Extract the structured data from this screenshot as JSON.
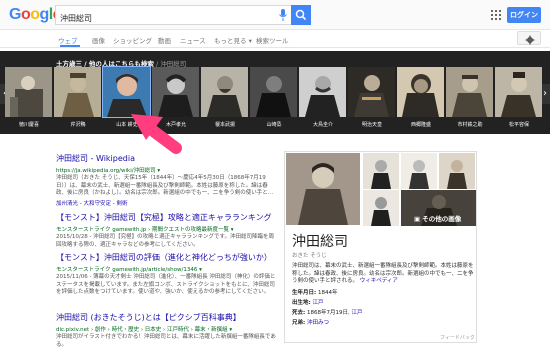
{
  "header": {
    "logo": [
      "G",
      "o",
      "o",
      "g",
      "l",
      "e"
    ],
    "search_value": "沖田総司",
    "login_label": "ログイン"
  },
  "tabs": [
    {
      "label": "ウェブ",
      "active": true
    },
    {
      "label": "画像"
    },
    {
      "label": "ショッピング"
    },
    {
      "label": "動画"
    },
    {
      "label": "ニュース"
    },
    {
      "label": "もっと見る ▾"
    },
    {
      "label": "検索ツール"
    }
  ],
  "carousel": {
    "title": "土方歳三 / 他の人はこちらも検索",
    "crumb": " / 沖田総司",
    "people": [
      {
        "name": "徳川慶喜"
      },
      {
        "name": "芹沢鴨"
      },
      {
        "name": "山本 耕史"
      },
      {
        "name": "木戸孝允"
      },
      {
        "name": "榎本武揚"
      },
      {
        "name": "山崎烝"
      },
      {
        "name": "大鳥圭介"
      },
      {
        "name": "明治天皇"
      },
      {
        "name": "西郷隆盛"
      },
      {
        "name": "市村鉄之助"
      },
      {
        "name": "松平容保"
      }
    ]
  },
  "results": [
    {
      "title": "沖田総司 - Wikipedia",
      "url": "https://ja.wikipedia.org/wiki/沖田総司 ▾",
      "snippet": "沖田総司（おきた そうじ、天保15年（1844年）〜慶応4年5月30日（1868年7月19日））は、幕末の武士、新選組一番隊組長及び撃剣師範。本姓は藤原を称した。諱は春政、後に房良（かねよし）。幼名は宗次郎。新選組の中でも一、二を争う剣の使い手と…",
      "link": "加州清光 - 大和守安定 - 剣術"
    },
    {
      "title": "【モンスト】沖田総司【究極】攻略と適正キャラランキング",
      "url": "モンスターストライク gamewith.jp › 期間クエストの攻略最新度一覧 ▾",
      "snippet": "2015/10/28 - 沖田総司【究極】の攻略と適正キャラランキングです。沖田総司降臨を周回攻略する際の、適正キャラなどの参考にしてください。",
      "link": ""
    },
    {
      "title": "【モンスト】沖田総司の評価（進化と神化どっちが強いか）",
      "url": "モンスターストライク gamewith.jp/article/show/1346 ▾",
      "snippet": "2015/11/06 - 簿幕の天才剣士 沖田総司（進化）、一番隊組長 沖田総司（神化）の評価とステータスを掲載しています。また左旗コンボ、ストライクショットをもとに、沖田総司を評価した点数をつけています。使い道や、強いか、使えるかの参考にしてください。",
      "link": ""
    },
    {
      "title": "沖田総司 (おきたそうじ)とは【ピクシブ百科事典】",
      "url": "dic.pixiv.net › 創作 › 時代・歴史 › 日本史 › 江戸時代 › 幕末・新撰組 ▾",
      "snippet": "沖田総司がイラスト付きでわかる！沖田総司とは、幕末に活躍した新撰組一番隊組長である。",
      "link": ""
    }
  ],
  "knowledge": {
    "more_images": "その他の画像",
    "title": "沖田総司",
    "subtitle": "おきた そうじ",
    "description": "沖田総司は、幕末の武士、新選組一番隊組長及び撃剣師範。本姓は藤原を称した。諱は春政、後に房良。幼名は宗次郎。新選組の中でも一、二を争う剣の使い手と評される。",
    "description_link": "ウィキペディア",
    "born_label": "生年月日:",
    "born_value": "1844年",
    "birthplace_label": "出生地:",
    "birthplace_value": "江戸",
    "died_label": "死去:",
    "died_value": "1868年7月19日,",
    "died_place": "江戸",
    "siblings_label": "兄弟:",
    "siblings_value": "沖田みつ",
    "feedback": "フィードバック"
  }
}
